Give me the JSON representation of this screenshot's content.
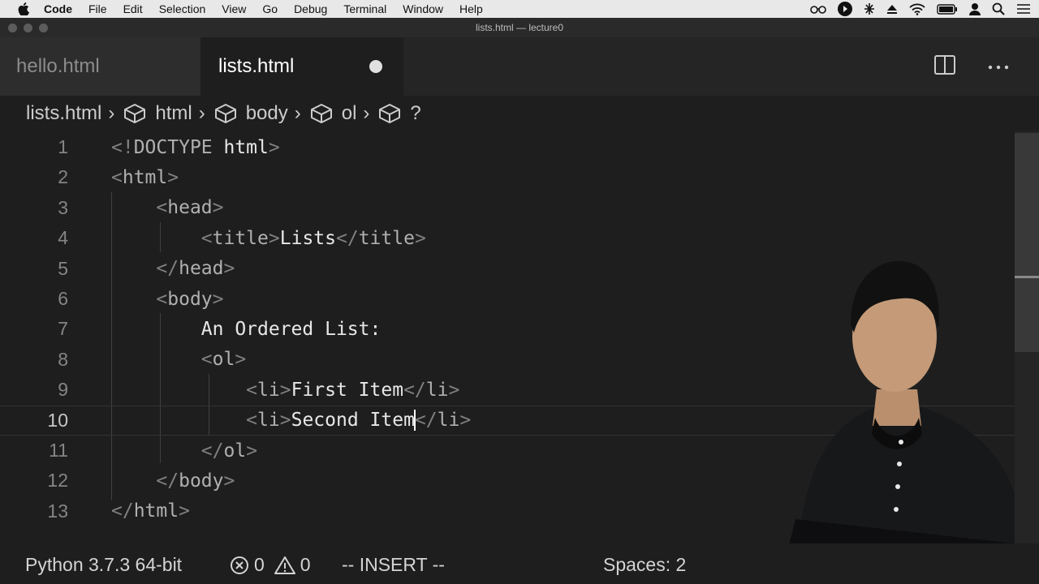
{
  "menubar": {
    "app_name": "Code",
    "items": [
      "File",
      "Edit",
      "Selection",
      "View",
      "Go",
      "Debug",
      "Terminal",
      "Window",
      "Help"
    ]
  },
  "window": {
    "title": "lists.html — lecture0"
  },
  "tabs": [
    {
      "label": "hello.html",
      "active": false
    },
    {
      "label": "lists.html",
      "active": true,
      "modified": true
    }
  ],
  "breadcrumb": {
    "file": "lists.html",
    "path": [
      "html",
      "body",
      "ol",
      "?"
    ]
  },
  "editor": {
    "active_line": 10,
    "lines": [
      {
        "n": "1",
        "parts": [
          [
            "tag",
            "<!"
          ],
          [
            "name",
            "DOCTYPE "
          ],
          [
            "txt",
            "html"
          ],
          [
            "tag",
            ">"
          ]
        ]
      },
      {
        "n": "2",
        "parts": [
          [
            "tag",
            "<"
          ],
          [
            "name",
            "html"
          ],
          [
            "tag",
            ">"
          ]
        ]
      },
      {
        "n": "3",
        "parts": [
          [
            "txt",
            "    "
          ],
          [
            "tag",
            "<"
          ],
          [
            "name",
            "head"
          ],
          [
            "tag",
            ">"
          ]
        ]
      },
      {
        "n": "4",
        "parts": [
          [
            "txt",
            "        "
          ],
          [
            "tag",
            "<"
          ],
          [
            "name",
            "title"
          ],
          [
            "tag",
            ">"
          ],
          [
            "txt",
            "Lists"
          ],
          [
            "tag",
            "</"
          ],
          [
            "name",
            "title"
          ],
          [
            "tag",
            ">"
          ]
        ]
      },
      {
        "n": "5",
        "parts": [
          [
            "txt",
            "    "
          ],
          [
            "tag",
            "</"
          ],
          [
            "name",
            "head"
          ],
          [
            "tag",
            ">"
          ]
        ]
      },
      {
        "n": "6",
        "parts": [
          [
            "txt",
            "    "
          ],
          [
            "tag",
            "<"
          ],
          [
            "name",
            "body"
          ],
          [
            "tag",
            ">"
          ]
        ]
      },
      {
        "n": "7",
        "parts": [
          [
            "txt",
            "        An Ordered List:"
          ]
        ]
      },
      {
        "n": "8",
        "parts": [
          [
            "txt",
            "        "
          ],
          [
            "tag",
            "<"
          ],
          [
            "name",
            "ol"
          ],
          [
            "tag",
            ">"
          ]
        ]
      },
      {
        "n": "9",
        "parts": [
          [
            "txt",
            "            "
          ],
          [
            "tag",
            "<"
          ],
          [
            "name",
            "li"
          ],
          [
            "tag",
            ">"
          ],
          [
            "txt",
            "First Item"
          ],
          [
            "tag",
            "</"
          ],
          [
            "name",
            "li"
          ],
          [
            "tag",
            ">"
          ]
        ]
      },
      {
        "n": "10",
        "parts": [
          [
            "txt",
            "            "
          ],
          [
            "tag",
            "<"
          ],
          [
            "name",
            "li"
          ],
          [
            "tag",
            ">"
          ],
          [
            "txt",
            "Second Item"
          ],
          [
            "cursor",
            ""
          ],
          [
            "tag",
            "</"
          ],
          [
            "name",
            "li"
          ],
          [
            "tag",
            ">"
          ]
        ]
      },
      {
        "n": "11",
        "parts": [
          [
            "txt",
            "        "
          ],
          [
            "tag",
            "</"
          ],
          [
            "name",
            "ol"
          ],
          [
            "tag",
            ">"
          ]
        ]
      },
      {
        "n": "12",
        "parts": [
          [
            "txt",
            "    "
          ],
          [
            "tag",
            "</"
          ],
          [
            "name",
            "body"
          ],
          [
            "tag",
            ">"
          ]
        ]
      },
      {
        "n": "13",
        "parts": [
          [
            "tag",
            "</"
          ],
          [
            "name",
            "html"
          ],
          [
            "tag",
            ">"
          ]
        ]
      }
    ]
  },
  "statusbar": {
    "interpreter": "Python 3.7.3 64-bit",
    "errors": "0",
    "warnings": "0",
    "mode": "-- INSERT --",
    "indent": "Spaces: 2"
  },
  "icons": {
    "apple": "apple-logo-icon",
    "split": "split-editor-icon",
    "more": "more-actions-icon",
    "symbol": "symbol-cube-icon",
    "error": "error-circle-icon",
    "warning": "warning-triangle-icon"
  },
  "colors": {
    "background": "#1e1e1e",
    "tab_inactive": "#2d2d2d",
    "menubar": "#e8e8e8"
  }
}
